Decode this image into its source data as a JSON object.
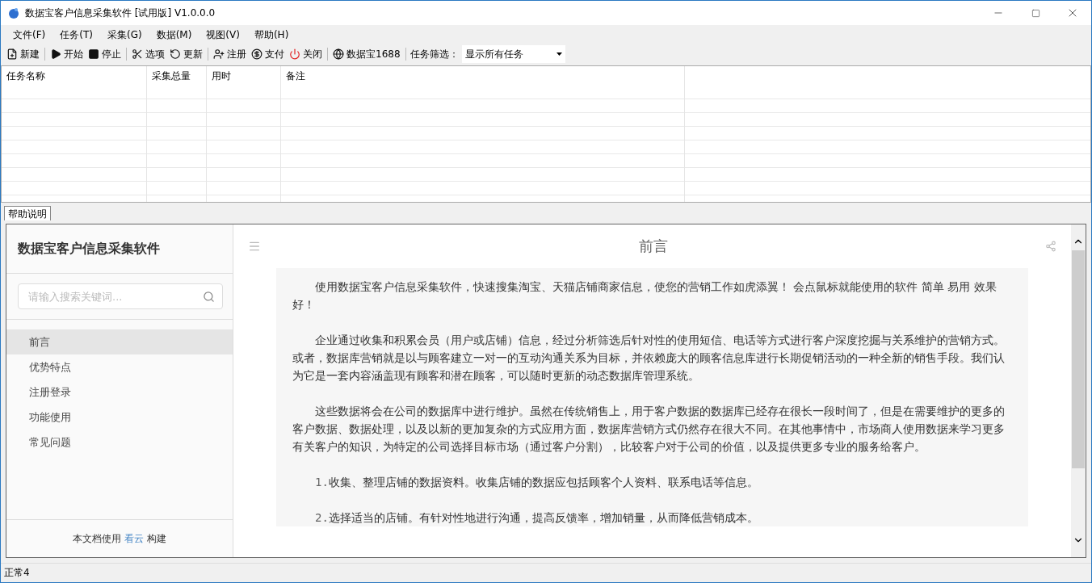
{
  "window": {
    "title": "数据宝客户信息采集软件 [试用版] V1.0.0.0"
  },
  "menu": [
    "文件(F)",
    "任务(T)",
    "采集(G)",
    "数据(M)",
    "视图(V)",
    "帮助(H)"
  ],
  "toolbar": [
    {
      "kind": "new",
      "label": "新建"
    },
    {
      "kind": "start",
      "label": "开始"
    },
    {
      "kind": "stop",
      "label": "停止"
    },
    {
      "kind": "options",
      "label": "选项"
    },
    {
      "kind": "update",
      "label": "更新"
    },
    {
      "kind": "register",
      "label": "注册"
    },
    {
      "kind": "pay",
      "label": "支付"
    },
    {
      "kind": "close",
      "label": "关闭"
    },
    {
      "kind": "site",
      "label": "数据宝1688"
    }
  ],
  "task_filter": {
    "label": "任务筛选：",
    "value": "显示所有任务"
  },
  "table": {
    "columns": [
      "任务名称",
      "采集总量",
      "用时",
      "备注"
    ]
  },
  "tabs": [
    {
      "label": "帮助说明",
      "selected": true
    }
  ],
  "help": {
    "title": "数据宝客户信息采集软件",
    "search": {
      "placeholder": "请输入搜索关键词..."
    },
    "nav": [
      {
        "label": "前言",
        "selected": true
      },
      {
        "label": "优势特点",
        "selected": false
      },
      {
        "label": "注册登录",
        "selected": false
      },
      {
        "label": "功能使用",
        "selected": false
      },
      {
        "label": "常见问题",
        "selected": false
      }
    ],
    "footer": {
      "before": "本文档使用",
      "link": "看云",
      "after": "构建"
    },
    "page_title": "前言",
    "paragraphs": [
      {
        "kind": "para",
        "text": "使用数据宝客户信息采集软件，快速搜集淘宝、天猫店铺商家信息，使您的营销工作如虎添翼！ 会点鼠标就能使用的软件 简单 易用 效果好！"
      },
      {
        "kind": "para",
        "text": "企业通过收集和积累会员（用户或店铺）信息，经过分析筛选后针对性的使用短信、电话等方式进行客户深度挖掘与关系维护的营销方式。或者，数据库营销就是以与顾客建立一对一的互动沟通关系为目标，并依赖庞大的顾客信息库进行长期促销活动的一种全新的销售手段。我们认为它是一套内容涵盖现有顾客和潜在顾客，可以随时更新的动态数据库管理系统。"
      },
      {
        "kind": "para",
        "text": "这些数据将会在公司的数据库中进行维护。虽然在传统销售上，用于客户数据的数据库已经存在很长一段时间了，但是在需要维护的更多的客户数据、数据处理，以及以新的更加复杂的方式应用方面，数据库营销方式仍然存在很大不同。在其他事情中，市场商人使用数据来学习更多有关客户的知识，为特定的公司选择目标市场（通过客户分割），比较客户对于公司的价值，以及提供更多专业的服务给客户。"
      },
      {
        "kind": "numbered",
        "number": "1.",
        "text": "收集、整理店铺的数据资料。收集店铺的数据应包括顾客个人资料、联系电话等信息。"
      },
      {
        "kind": "numbered",
        "number": "2.",
        "text": "选择适当的店铺。有针对性地进行沟通，提高反馈率，增加销量，从而降低营销成本。"
      }
    ]
  },
  "status_bar": "正常4"
}
